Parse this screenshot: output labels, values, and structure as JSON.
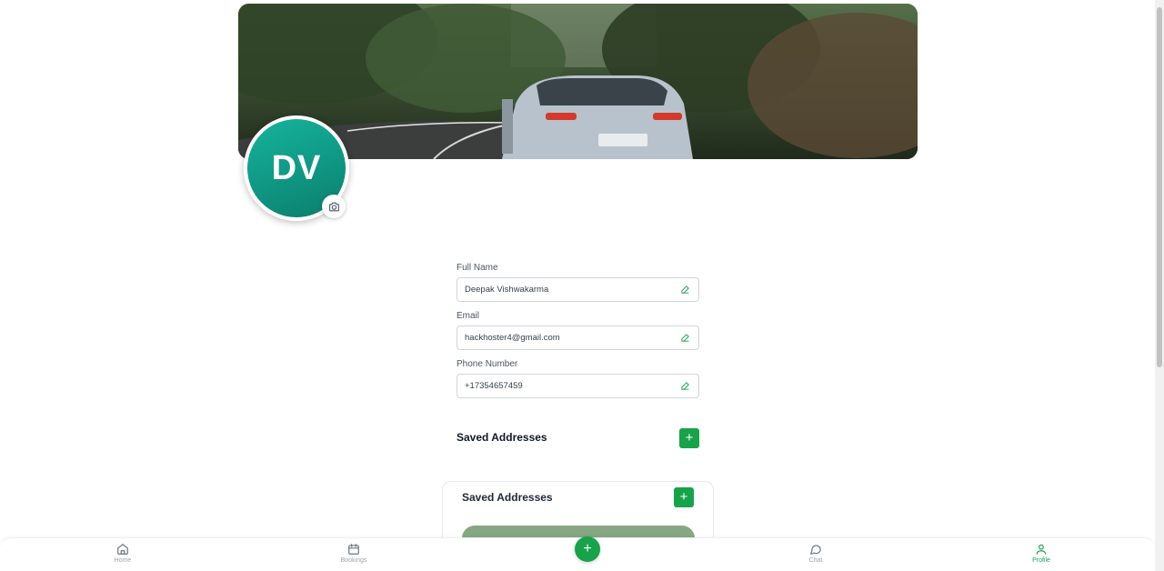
{
  "profile": {
    "initials": "DV",
    "camera_icon": "camera-icon"
  },
  "form": {
    "full_name": {
      "label": "Full Name",
      "value": "Deepak Vishwakarma"
    },
    "email": {
      "label": "Email",
      "value": "hackhoster4@gmail.com"
    },
    "phone": {
      "label": "Phone Number",
      "value": "+17354657459"
    },
    "edit_icon": "pencil-icon"
  },
  "saved_addresses": {
    "title": "Saved Addresses",
    "add_label": "+"
  },
  "address_card": {
    "title": "Saved Addresses",
    "add_label": "+"
  },
  "bottom_nav": {
    "items": [
      {
        "label": "Home",
        "icon": "home-icon"
      },
      {
        "label": "Bookings",
        "icon": "calendar-icon"
      },
      {
        "label": "Chat",
        "icon": "chat-icon"
      },
      {
        "label": "Profile",
        "icon": "user-icon"
      }
    ],
    "fab_label": "+",
    "active": "Profile"
  },
  "colors": {
    "accent": "#16a34a",
    "avatar": "#0f9a86",
    "card_bar": "#86a784"
  }
}
